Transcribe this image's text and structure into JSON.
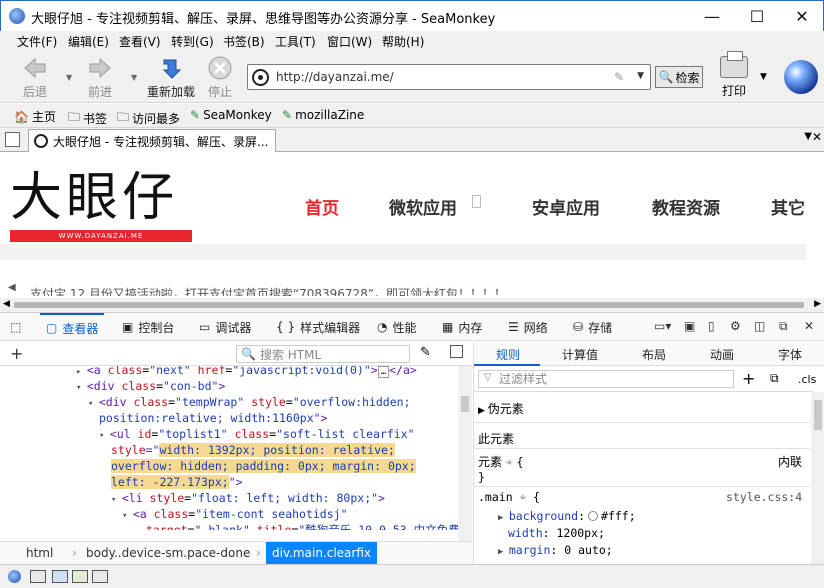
{
  "window": {
    "title": "大眼仔旭 - 专注视频剪辑、解压、录屏、思维导图等办公资源分享 - SeaMonkey",
    "min": "—",
    "max": "☐",
    "close": "✕"
  },
  "menu": [
    "文件(F)",
    "编辑(E)",
    "查看(V)",
    "转到(G)",
    "书签(B)",
    "工具(T)",
    "窗口(W)",
    "帮助(H)"
  ],
  "nav": {
    "back": "后退",
    "forward": "前进",
    "reload": "重新加载",
    "stop": "停止",
    "url": "http://dayanzai.me/",
    "search": "检索",
    "print": "打印"
  },
  "bookmarks": [
    "主页",
    "书签",
    "访问最多",
    "SeaMonkey",
    "mozillaZine"
  ],
  "tab": {
    "title": "大眼仔旭 - 专注视频剪辑、解压、录屏..."
  },
  "site": {
    "logo_text": "大眼仔",
    "logo_url": "WWW.DAYANZAI.ME",
    "nav": [
      "首页",
      "微软应用",
      "安卓应用",
      "教程资源",
      "其它"
    ],
    "notice": "支付宝 12 月份又搞活动啦，打开支付宝首页搜索“708396728”，即可领大红包！！！！"
  },
  "devtools": {
    "tabs": [
      "查看器",
      "控制台",
      "调试器",
      "样式编辑器",
      "性能",
      "内存",
      "网络",
      "存储"
    ],
    "search_placeholder": "搜索 HTML",
    "markup": {
      "l1": {
        "open": "<a ",
        "a1": "class",
        "v1": "\"next\"",
        "a2": "href",
        "v2": "\"javascript:void(0)\"",
        "close": ">",
        "ellipsis": "…",
        "end": "</a>"
      },
      "l2": {
        "text": "<div class=\"con-bd\">",
        "tag": "<div ",
        "a": "class",
        "v": "\"con-bd\"",
        "close": ">"
      },
      "l3": {
        "tag": "<div ",
        "a1": "class",
        "v1": "\"tempWrap\"",
        "a2": "style",
        "v2": "\"overflow:hidden;"
      },
      "l4": {
        "v": "position:relative; width:1160px\"",
        "close": ">"
      },
      "l5": {
        "tag": "<ul ",
        "a1": "id",
        "v1": "\"toplist1\"",
        "a2": "class",
        "v2": "\"soft-list clearfix\""
      },
      "l6": {
        "a": "style",
        "q": "=\"",
        "v": "width: 1392px; position: relative;"
      },
      "l7": {
        "v": "overflow: hidden; padding: 0px; margin: 0px;"
      },
      "l8": {
        "v": "left: -227.173px;",
        "close": "\">"
      },
      "l9": {
        "tag": "<li ",
        "a": "style",
        "v": "\"float: left; width: 80px;\"",
        "close": ">"
      },
      "l10": {
        "tag": "<a ",
        "a": "class",
        "v": "\"item-cont seahotidsj\""
      },
      "l11": {
        "a": "target",
        "v": "\"_blank\"",
        "a2": "title",
        "v2": "\"酷狗音乐 10.0.53 中文免费"
      }
    },
    "breadcrumbs": [
      "html",
      "body..device-sm.pace-done",
      "div.main.clearfix"
    ],
    "rules_tabs": [
      "规则",
      "计算值",
      "布局",
      "动画",
      "字体"
    ],
    "rules_filter": "过滤样式",
    "cls": ".cls",
    "pseudo": "伪元素",
    "this_element": "此元素",
    "element_label": "元素",
    "element_brace": "{",
    "inline": "内联",
    "close_brace": "}",
    "rule_selector": ".main",
    "rule_source": "style.css:4",
    "rule_props": [
      {
        "name": "background",
        "value": "#fff;"
      },
      {
        "name": "width",
        "value": "1200px;"
      },
      {
        "name": "margin",
        "value": "0 auto;"
      }
    ]
  }
}
